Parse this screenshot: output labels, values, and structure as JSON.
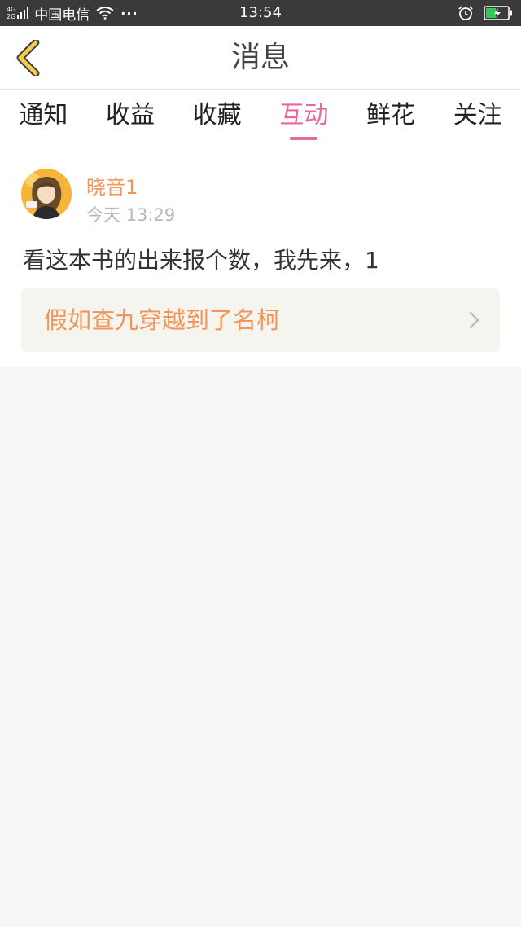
{
  "status_bar": {
    "network_top": "4G",
    "network_bottom": "2G",
    "carrier": "中国电信",
    "more": "···",
    "time": "13:54"
  },
  "nav": {
    "title": "消息"
  },
  "tabs": [
    {
      "label": "通知",
      "active": false
    },
    {
      "label": "收益",
      "active": false
    },
    {
      "label": "收藏",
      "active": false
    },
    {
      "label": "互动",
      "active": true
    },
    {
      "label": "鲜花",
      "active": false
    },
    {
      "label": "关注",
      "active": false
    }
  ],
  "message": {
    "username": "晓音1",
    "time": "今天 13:29",
    "text": "看这本书的出来报个数，我先来，1",
    "book_title": "假如查九穿越到了名柯"
  },
  "colors": {
    "accent": "#e8679c",
    "orange": "#f0965a",
    "back_arrow": "#f1cc49"
  }
}
